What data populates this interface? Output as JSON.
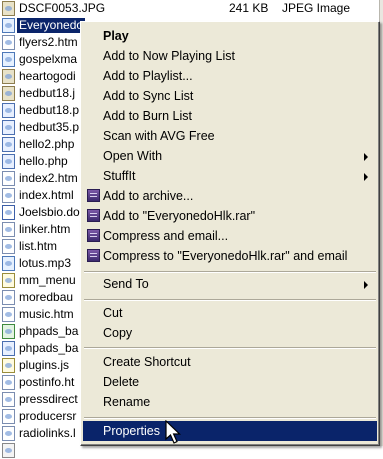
{
  "files": [
    {
      "name": "DSCF0053.JPG",
      "size": "241 KB",
      "type": "JPEG Image",
      "kind": "jpg"
    },
    {
      "name": "Everyonedo",
      "size": "",
      "type": "",
      "kind": "mp3",
      "selected": true
    },
    {
      "name": "flyers2.htm",
      "kind": "html"
    },
    {
      "name": "gospelxma",
      "kind": "mp3"
    },
    {
      "name": "heartogodi",
      "kind": "jpg"
    },
    {
      "name": "hedbut18.j",
      "kind": "jpg"
    },
    {
      "name": "hedbut18.p",
      "kind": "php"
    },
    {
      "name": "hedbut35.p",
      "kind": "php"
    },
    {
      "name": "hello2.php",
      "kind": "php"
    },
    {
      "name": "hello.php",
      "kind": "php"
    },
    {
      "name": "index2.htm",
      "kind": "html"
    },
    {
      "name": "index.html",
      "kind": "html"
    },
    {
      "name": "Joelsbio.do",
      "kind": "doc"
    },
    {
      "name": "linker.htm",
      "kind": "html"
    },
    {
      "name": "list.htm",
      "kind": "html"
    },
    {
      "name": "lotus.mp3",
      "kind": "mp3"
    },
    {
      "name": "mm_menu",
      "kind": "js"
    },
    {
      "name": "moredbau",
      "kind": "html"
    },
    {
      "name": "music.htm",
      "kind": "html"
    },
    {
      "name": "phpads_ba",
      "kind": "xls"
    },
    {
      "name": "phpads_ba",
      "kind": "php"
    },
    {
      "name": "plugins.js",
      "kind": "js"
    },
    {
      "name": "postinfo.ht",
      "kind": "html"
    },
    {
      "name": "pressdirect",
      "kind": "html"
    },
    {
      "name": "producersr",
      "kind": "html"
    },
    {
      "name": "radiolinks.l",
      "kind": "html"
    },
    {
      "name": "",
      "kind": "inf"
    }
  ],
  "menu": {
    "play": "Play",
    "add_now_playing": "Add to Now Playing List",
    "add_playlist": "Add to Playlist...",
    "add_sync": "Add to Sync List",
    "add_burn": "Add to Burn List",
    "scan_avg": "Scan with AVG Free",
    "open_with": "Open With",
    "stuffit": "StuffIt",
    "add_archive": "Add to archive...",
    "add_to_rar": "Add to \"EveryonedoHlk.rar\"",
    "compress_email": "Compress and email...",
    "compress_rar_email": "Compress to \"EveryonedoHlk.rar\" and email",
    "send_to": "Send To",
    "cut": "Cut",
    "copy": "Copy",
    "create_shortcut": "Create Shortcut",
    "delete": "Delete",
    "rename": "Rename",
    "properties": "Properties"
  },
  "icons": {
    "winrar": "winrar-icon",
    "submenu": "chevron-right-icon",
    "cursor": "mouse-pointer-icon"
  }
}
